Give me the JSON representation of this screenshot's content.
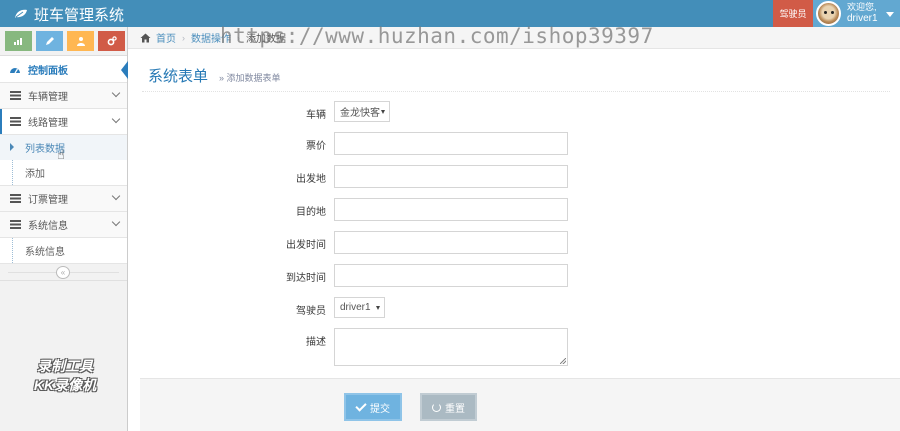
{
  "app": {
    "title": "班车管理系统"
  },
  "header": {
    "role_badge": "驾驶员",
    "welcome": "欢迎您,",
    "username": "driver1"
  },
  "sidebar": {
    "shortcut_icons": [
      "signal-icon",
      "pencil-icon",
      "users-icon",
      "cogs-icon"
    ],
    "items": [
      {
        "label": "控制面板",
        "icon": "dashboard-icon"
      },
      {
        "label": "车辆管理",
        "icon": "list-icon"
      },
      {
        "label": "线路管理",
        "icon": "list-icon"
      },
      {
        "label": "订票管理",
        "icon": "list-icon"
      },
      {
        "label": "系统信息",
        "icon": "list-icon"
      }
    ],
    "route_sub": [
      "列表数据",
      "添加"
    ],
    "system_sub": [
      "系统信息"
    ],
    "collapse_glyph": "«"
  },
  "breadcrumb": {
    "home": "首页",
    "section": "数据操作",
    "current": "添加数据"
  },
  "watermark": {
    "url": "https://www.huzhan.com/ishop39397",
    "recorder_line1": "录制工具",
    "recorder_line2": "KK录像机"
  },
  "page": {
    "title": "系统表单",
    "subtitle": "» 添加数据表单"
  },
  "form": {
    "vehicle_label": "车辆",
    "vehicle_value": "金龙快客",
    "price_label": "票价",
    "departure_label": "出发地",
    "destination_label": "目的地",
    "depart_time_label": "出发时间",
    "arrive_time_label": "到达时间",
    "driver_label": "驾驶员",
    "driver_value": "driver1",
    "desc_label": "描述",
    "submit_label": "提交",
    "reset_label": "重置"
  },
  "colors": {
    "navbar": "#438eb9",
    "role_badge": "#d15b47",
    "submit": "#6fb3e0",
    "reset": "#abbac3",
    "title": "#2679b5"
  }
}
